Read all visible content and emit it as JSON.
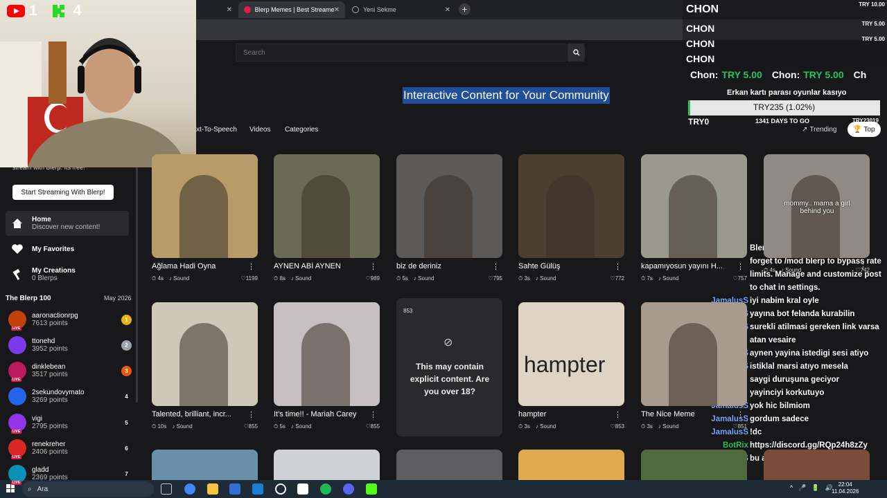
{
  "browser": {
    "tabs": [
      {
        "label": "",
        "active": false
      },
      {
        "label": "Blerp Memes | Best Streamer S...",
        "active": true
      },
      {
        "label": "Yeni Sekme",
        "active": false
      }
    ],
    "newtab": "+"
  },
  "header": {
    "search_placeholder": "Search",
    "hero": "Interactive Content for Your Community",
    "nav_tabs": [
      "xt-To-Speech",
      "Videos",
      "Categories"
    ],
    "trending": "Trending",
    "top": "Top"
  },
  "sidebar": {
    "promo_text": "stream with Blerp. Its free!",
    "promo_button": "Start Streaming With Blerp!",
    "nav": [
      {
        "label": "Home",
        "sub": "Discover new content!"
      },
      {
        "label": "My Favorites",
        "sub": ""
      },
      {
        "label": "My Creations",
        "sub": "0 Blerps"
      }
    ],
    "leaderboard_title": "The Blerp 100",
    "leaderboard_date": "May 2026",
    "leaderboard": [
      {
        "name": "aaronactionrpg",
        "points": "7613 points",
        "rank": "1",
        "live": true,
        "color": "#c2410c",
        "rank_color": "#eab308"
      },
      {
        "name": "ttonehd",
        "points": "3952 points",
        "rank": "2",
        "live": false,
        "color": "#7c3aed",
        "rank_color": "#9ca3af"
      },
      {
        "name": "dinklebean",
        "points": "3517 points",
        "rank": "3",
        "live": true,
        "color": "#be185d",
        "rank_color": "#ea580c"
      },
      {
        "name": "2sekundovymato",
        "points": "3269 points",
        "rank": "4",
        "live": false,
        "color": "#2563eb",
        "rank_color": "transparent"
      },
      {
        "name": "vigi",
        "points": "2795 points",
        "rank": "5",
        "live": true,
        "color": "#9333ea",
        "rank_color": "transparent"
      },
      {
        "name": "renekreher",
        "points": "2406 points",
        "rank": "6",
        "live": true,
        "color": "#dc2626",
        "rank_color": "transparent"
      },
      {
        "name": "gladd",
        "points": "2369 points",
        "rank": "7",
        "live": true,
        "color": "#0891b2",
        "rank_color": "transparent"
      }
    ],
    "live_label": "LIVE"
  },
  "grid": {
    "row1": [
      {
        "title": "Ağlama Hadi Oyna",
        "dur": "4s",
        "likes": "1199",
        "bg": "#b79c6a"
      },
      {
        "title": "AYNEN ABİ AYNEN",
        "dur": "8s",
        "likes": "989",
        "bg": "#6b6a55"
      },
      {
        "title": "biz de deriniz",
        "dur": "5s",
        "likes": "795",
        "bg": "#5b5a58"
      },
      {
        "title": "Sahte Gülüş",
        "dur": "3s",
        "likes": "772",
        "bg": "#4b3f2f"
      },
      {
        "title": "kapamıyosun yayını H...",
        "dur": "7s",
        "likes": "757",
        "bg": "#9a9a8c"
      },
      {
        "title": "",
        "dur": "4s",
        "likes": "742",
        "bg": "#8f8a84"
      }
    ],
    "row2": [
      {
        "title": "Talented, brilliant, incr...",
        "dur": "10s",
        "likes": "855",
        "bg": "#cfc7b8"
      },
      {
        "title": "It's time!! - Mariah Carey",
        "dur": "5s",
        "likes": "855",
        "bg": "#c7c0c2"
      },
      {
        "title": "",
        "dur": "",
        "likes": "853",
        "bg": "#2a2a2d"
      },
      {
        "title": "hampter",
        "dur": "3s",
        "likes": "853",
        "bg": "#ddd4c6"
      },
      {
        "title": "The Nice Meme",
        "dur": "3s",
        "likes": "851",
        "bg": "#a89a8c"
      }
    ],
    "sound_label": "Sound",
    "explicit_text": "This may contain explicit content. Are you over 18?",
    "hampter_caption": "hampter",
    "tiktok_caption": "mommy.. mama a girl behind you"
  },
  "stream": {
    "counts": {
      "youtube": "1",
      "kick": "4"
    },
    "tips": [
      {
        "name": "CHON",
        "amount": "TRY 10.00"
      },
      {
        "name": "CHON",
        "amount": "TRY 5.00"
      },
      {
        "name": "CHON",
        "amount": "TRY 5.00"
      },
      {
        "name": "CHON",
        "amount": ""
      }
    ],
    "ticker": [
      {
        "name": "Chon:",
        "amount": "TRY 5.00"
      },
      {
        "name": "Chon:",
        "amount": "TRY 5.00"
      },
      {
        "name": "Ch",
        "amount": ""
      }
    ],
    "goal": {
      "title": "Erkan kartı parası oyunlar kasıyo",
      "label": "TRY235 (1.02%)",
      "progress": 0.0102,
      "start": "TRY0",
      "days": "1341 DAYS TO GO",
      "end": "TRY23019"
    },
    "chat": [
      {
        "user": "",
        "text": "Blerp account with Kick! Don't"
      },
      {
        "user": "",
        "text": "forget to /mod blerp to bypass rate"
      },
      {
        "user": "",
        "text": "limits. Manage and customize post"
      },
      {
        "user": "",
        "text": "to chat in settings."
      },
      {
        "user": "JamalusS",
        "text": "iyi nabim kral oyle"
      },
      {
        "user": "JamalusS",
        "text": "yayına bot felanda kurabilin"
      },
      {
        "user": "JamalusS",
        "text": "surekli atilmasi gereken link varsa"
      },
      {
        "user": "",
        "text": "atan vesaire"
      },
      {
        "user": "JamalusS",
        "text": "aynen yayina istedigi sesi atiyo"
      },
      {
        "user": "JamalusS",
        "text": "istiklal marsi atıyo mesela"
      },
      {
        "user": "",
        "text": "saygi duruşuna geciyor"
      },
      {
        "user": "",
        "text": "yayinciyi korkutuyo"
      },
      {
        "user": "JamalusS",
        "text": "yok hic bilmiom"
      },
      {
        "user": "JamalusS",
        "text": "gordum sadece"
      },
      {
        "user": "JamalusS",
        "text": "!dc"
      },
      {
        "user": "BotRix",
        "text": "https://discord.gg/RQp24h8zZy"
      },
      {
        "user": "JamalusS",
        "text": "bu adam evrimlesiyor"
      }
    ]
  },
  "taskbar": {
    "search": "Ara",
    "time": "22:04",
    "date": "11.04.2026"
  },
  "colors": {
    "accent": "#1f4e9a",
    "bg": "#18181b",
    "botrix": "#22c55e",
    "try": "#22c55e"
  }
}
